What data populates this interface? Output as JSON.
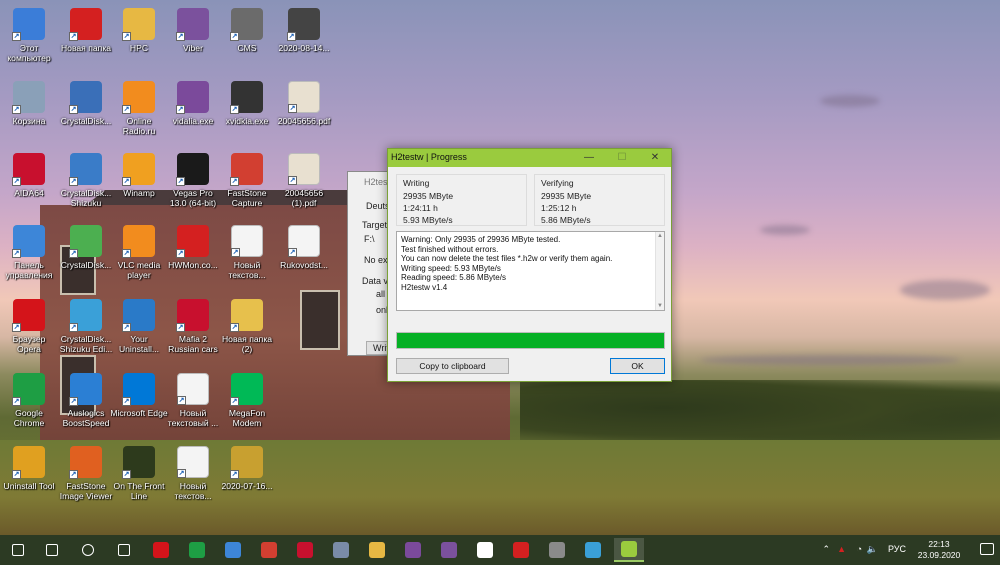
{
  "desktop": {
    "icons": [
      {
        "label": "Этот компьютер",
        "icon": "computer-icon",
        "color": "#3b7dd8"
      },
      {
        "label": "Новая папка",
        "icon": "red-x-folder-icon",
        "color": "#d42020"
      },
      {
        "label": "HPC",
        "icon": "folder-user-icon",
        "color": "#e7b843"
      },
      {
        "label": "Viber",
        "icon": "viber-icon",
        "color": "#7b519d"
      },
      {
        "label": "CMS",
        "icon": "webcam-icon",
        "color": "#6b6b6b"
      },
      {
        "label": "2020-08-14...",
        "icon": "image-file-icon",
        "color": "#444444"
      },
      {
        "label": "Корзина",
        "icon": "recycle-bin-icon",
        "color": "#8aa0b8"
      },
      {
        "label": "CrystalDisk...",
        "icon": "crystaldisk-icon",
        "color": "#3a6fb8"
      },
      {
        "label": "Online Radio.ru",
        "icon": "vlc-icon",
        "color": "#f28c1e"
      },
      {
        "label": "vidalia.exe",
        "icon": "tor-onion-icon",
        "color": "#7b4a9b"
      },
      {
        "label": "xvidkia.exe",
        "icon": "camera-icon",
        "color": "#333333"
      },
      {
        "label": "20045656.pdf",
        "icon": "pdf-file-icon",
        "color": "#e8e0d0"
      },
      {
        "label": "AIDA64",
        "icon": "aida64-icon",
        "color": "#c8102e"
      },
      {
        "label": "CrystalDisk... Shizuku",
        "icon": "crystaldisk-shizuku-icon",
        "color": "#3a7cc8"
      },
      {
        "label": "Winamp",
        "icon": "winamp-icon",
        "color": "#f0a020"
      },
      {
        "label": "Vegas Pro 13.0 (64-bit)",
        "icon": "vegas-icon",
        "color": "#1a1a1a"
      },
      {
        "label": "FastStone Capture",
        "icon": "faststone-capture-icon",
        "color": "#d23f31"
      },
      {
        "label": "20045656 (1).pdf",
        "icon": "pdf-file-icon",
        "color": "#e8e0d0"
      },
      {
        "label": "Панель управления",
        "icon": "control-panel-icon",
        "color": "#3d86d8"
      },
      {
        "label": "CrystalDisk...",
        "icon": "crystaldisk-green-icon",
        "color": "#4caf50"
      },
      {
        "label": "VLC media player",
        "icon": "vlc-icon",
        "color": "#f28c1e"
      },
      {
        "label": "HWMon.co...",
        "icon": "hwmonitor-icon",
        "color": "#d42020"
      },
      {
        "label": "Новый текстов...",
        "icon": "text-file-icon",
        "color": "#f4f4f4"
      },
      {
        "label": "Rukovodst...",
        "icon": "document-icon",
        "color": "#f4f4f4"
      },
      {
        "label": "Браузер Opera",
        "icon": "opera-icon",
        "color": "#d4141a"
      },
      {
        "label": "CrystalDisk... Shizuku Edi...",
        "icon": "crystaldisk-shizuku-icon",
        "color": "#3aa0d8"
      },
      {
        "label": "Your Uninstall...",
        "icon": "your-uninstaller-icon",
        "color": "#2a7ac8"
      },
      {
        "label": "Mafia 2 Russian cars",
        "icon": "mafia-icon",
        "color": "#c8102e"
      },
      {
        "label": "Новая папка (2)",
        "icon": "folder-icon",
        "color": "#e7c04c"
      },
      {
        "label": "Google Chrome",
        "icon": "chrome-icon",
        "color": "#1e9e44"
      },
      {
        "label": "Auslogics BoostSpeed",
        "icon": "auslogics-icon",
        "color": "#2b7fd4"
      },
      {
        "label": "Microsoft Edge",
        "icon": "edge-icon",
        "color": "#0078d7"
      },
      {
        "label": "Новый текстовый ...",
        "icon": "text-file-icon",
        "color": "#f4f4f4"
      },
      {
        "label": "MegaFon Modem",
        "icon": "megafon-icon",
        "color": "#00b956"
      },
      {
        "label": "Uninstall Tool",
        "icon": "uninstall-tool-icon",
        "color": "#e0a020"
      },
      {
        "label": "FastStone Image Viewer",
        "icon": "faststone-viewer-icon",
        "color": "#e06020"
      },
      {
        "label": "On The Front Line",
        "icon": "game-soldier-icon",
        "color": "#2d3a1c"
      },
      {
        "label": "Новый текстов...",
        "icon": "text-file-icon",
        "color": "#f4f4f4"
      },
      {
        "label": "2020-07-16...",
        "icon": "archive-icon",
        "color": "#c8a030"
      }
    ]
  },
  "bg_window": {
    "title": "H2tes",
    "lang": "Deuts",
    "target_label": "Target",
    "target_value": "F:\\",
    "no_ex": "No exi",
    "data_vol": "Data vo",
    "opt_all": "all a",
    "opt_only": "onl",
    "write_btn": "Writ"
  },
  "dialog": {
    "title": "H2testw | Progress",
    "minimize": "—",
    "maximize": "☐",
    "close": "✕",
    "writing": {
      "heading": "Writing",
      "size": "29935 MByte",
      "time": "1:24:11 h",
      "speed": "5.93 MByte/s"
    },
    "verifying": {
      "heading": "Verifying",
      "size": "29935 MByte",
      "time": "1:25:12 h",
      "speed": "5.86 MByte/s"
    },
    "log_lines": [
      "Warning: Only 29935 of 29936 MByte tested.",
      "Test finished without errors.",
      "You can now delete the test files *.h2w or verify them again.",
      "Writing speed: 5.93 MByte/s",
      "Reading speed: 5.86 MByte/s",
      "H2testw v1.4"
    ],
    "progress": 1.0,
    "progress_color": "#06b025",
    "copy_button": "Copy to clipboard",
    "ok_button": "OK",
    "titlebar_color": "#9acb3e"
  },
  "taskbar": {
    "apps": [
      {
        "icon": "windows-start-icon",
        "color": "#ffffff"
      },
      {
        "icon": "search-icon",
        "color": "#ffffff"
      },
      {
        "icon": "cortana-circle-icon",
        "color": "#ffffff"
      },
      {
        "icon": "task-view-icon",
        "color": "#ffffff"
      },
      {
        "icon": "opera-icon",
        "color": "#d4141a"
      },
      {
        "icon": "chrome-icon",
        "color": "#1e9e44"
      },
      {
        "icon": "globe-icon",
        "color": "#3d86d8"
      },
      {
        "icon": "faststone-capture-icon",
        "color": "#d23f31"
      },
      {
        "icon": "aida64-icon",
        "color": "#c8102e"
      },
      {
        "icon": "disk-icon",
        "color": "#7a8ca8"
      },
      {
        "icon": "file-explorer-icon",
        "color": "#e7b843"
      },
      {
        "icon": "tor-onion-icon",
        "color": "#7b4a9b"
      },
      {
        "icon": "viber-icon",
        "color": "#7b519d"
      },
      {
        "icon": "shield-icon",
        "color": "#ffffff"
      },
      {
        "icon": "hwmonitor-icon",
        "color": "#d42020"
      },
      {
        "icon": "webcam-icon",
        "color": "#8a8a8a"
      },
      {
        "icon": "gear-sun-icon",
        "color": "#3aa0d8"
      },
      {
        "icon": "h2testw-icon",
        "color": "#9acb3e"
      }
    ],
    "tray": {
      "lang": "РУС",
      "time": "22:13",
      "date": "23.09.2020"
    }
  }
}
